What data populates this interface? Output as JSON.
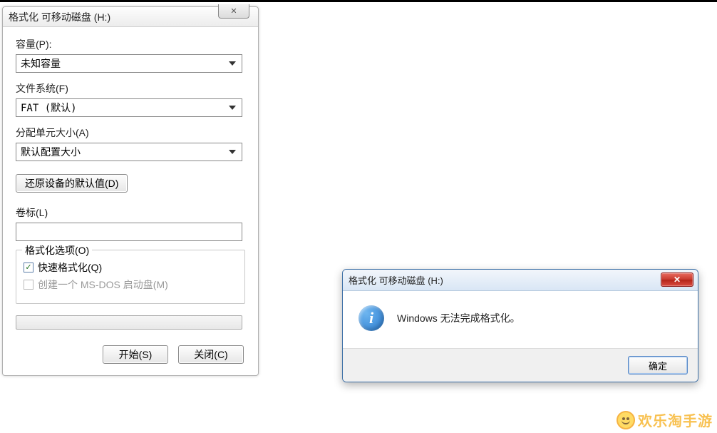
{
  "format_dialog": {
    "title": "格式化 可移动磁盘 (H:)",
    "capacity_label": "容量(P):",
    "capacity_value": "未知容量",
    "filesystem_label": "文件系统(F)",
    "filesystem_value": "FAT (默认)",
    "alloc_label": "分配单元大小(A)",
    "alloc_value": "默认配置大小",
    "restore_defaults": "还原设备的默认值(D)",
    "volume_label_label": "卷标(L)",
    "volume_label_value": "",
    "options_group_title": "格式化选项(O)",
    "quick_format_label": "快速格式化(Q)",
    "quick_format_checked": true,
    "msdos_label": "创建一个 MS-DOS 启动盘(M)",
    "msdos_checked": false,
    "start_button": "开始(S)",
    "close_button": "关闭(C)",
    "close_x": "✕"
  },
  "message_box": {
    "title": "格式化 可移动磁盘 (H:)",
    "icon": "info-icon",
    "icon_glyph": "i",
    "message": "Windows 无法完成格式化。",
    "ok_button": "确定",
    "close_x": "✕"
  },
  "watermark": {
    "text": "欢乐淘手游"
  }
}
